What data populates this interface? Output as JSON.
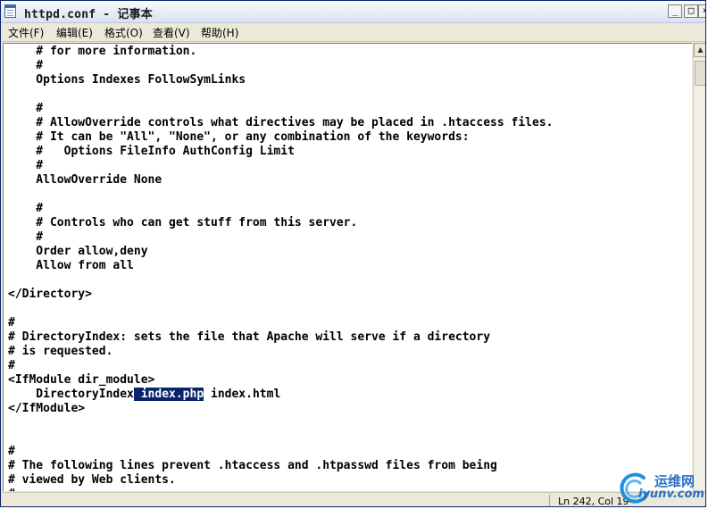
{
  "window": {
    "title": "httpd.conf - 记事本"
  },
  "title_buttons": {
    "minimize": "_",
    "maximize": "□",
    "close": "×"
  },
  "menu": [
    "文件(F)",
    "编辑(E)",
    "格式(O)",
    "查看(V)",
    "帮助(H)"
  ],
  "editor": {
    "lines": [
      "    # for more information.",
      "    #",
      "    Options Indexes FollowSymLinks",
      "",
      "    #",
      "    # AllowOverride controls what directives may be placed in .htaccess files.",
      "    # It can be \"All\", \"None\", or any combination of the keywords:",
      "    #   Options FileInfo AuthConfig Limit",
      "    #",
      "    AllowOverride None",
      "",
      "    #",
      "    # Controls who can get stuff from this server.",
      "    #",
      "    Order allow,deny",
      "    Allow from all",
      "",
      "</Directory>",
      "",
      "#",
      "# DirectoryIndex: sets the file that Apache will serve if a directory",
      "# is requested.",
      "#",
      "<IfModule dir_module>",
      "",
      "</IfModule>",
      "",
      "",
      "#",
      "# The following lines prevent .htaccess and .htpasswd files from being",
      "# viewed by Web clients.",
      "#"
    ],
    "directory_index_line": {
      "before": "    DirectoryIndex",
      "selected": " index.php",
      "after": " index.html"
    }
  },
  "scrollbar": {
    "up_arrow": "▲"
  },
  "status": {
    "position": "Ln 242, Col 19"
  },
  "watermark": {
    "name": "运维网",
    "url": "iyunv.com"
  }
}
